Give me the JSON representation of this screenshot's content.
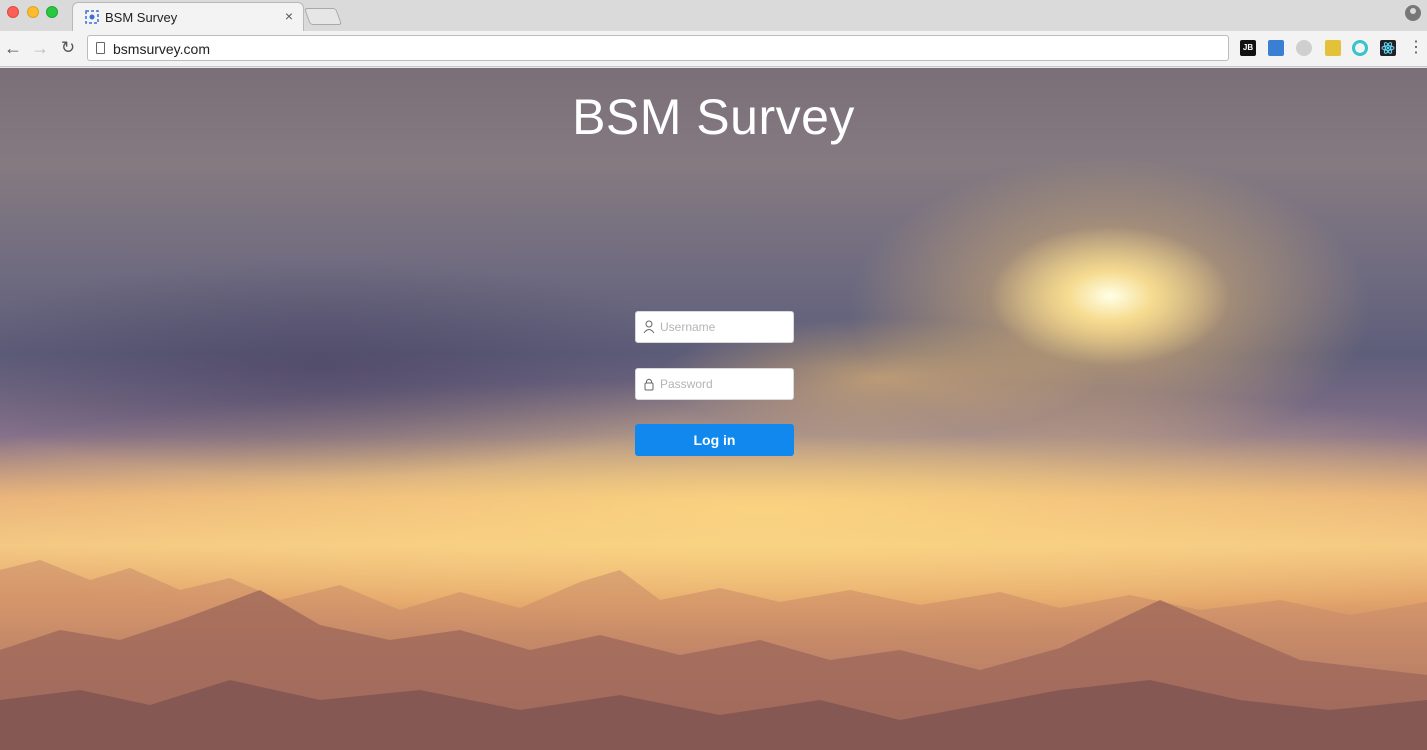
{
  "browser": {
    "tab": {
      "title": "BSM Survey",
      "close_glyph": "×"
    },
    "url": "bsmsurvey.com",
    "extensions": [
      "jetbrains-icon",
      "blue-extension-icon",
      "grey-extension-icon",
      "dropper-extension-icon",
      "circle-extension-icon",
      "react-devtools-icon"
    ],
    "ext_jb_label": "JB"
  },
  "page": {
    "title": "BSM Survey",
    "username_placeholder": "Username",
    "password_placeholder": "Password",
    "login_label": "Log in"
  },
  "colors": {
    "primary_button": "#1088ee",
    "title_text": "#ffffff"
  }
}
